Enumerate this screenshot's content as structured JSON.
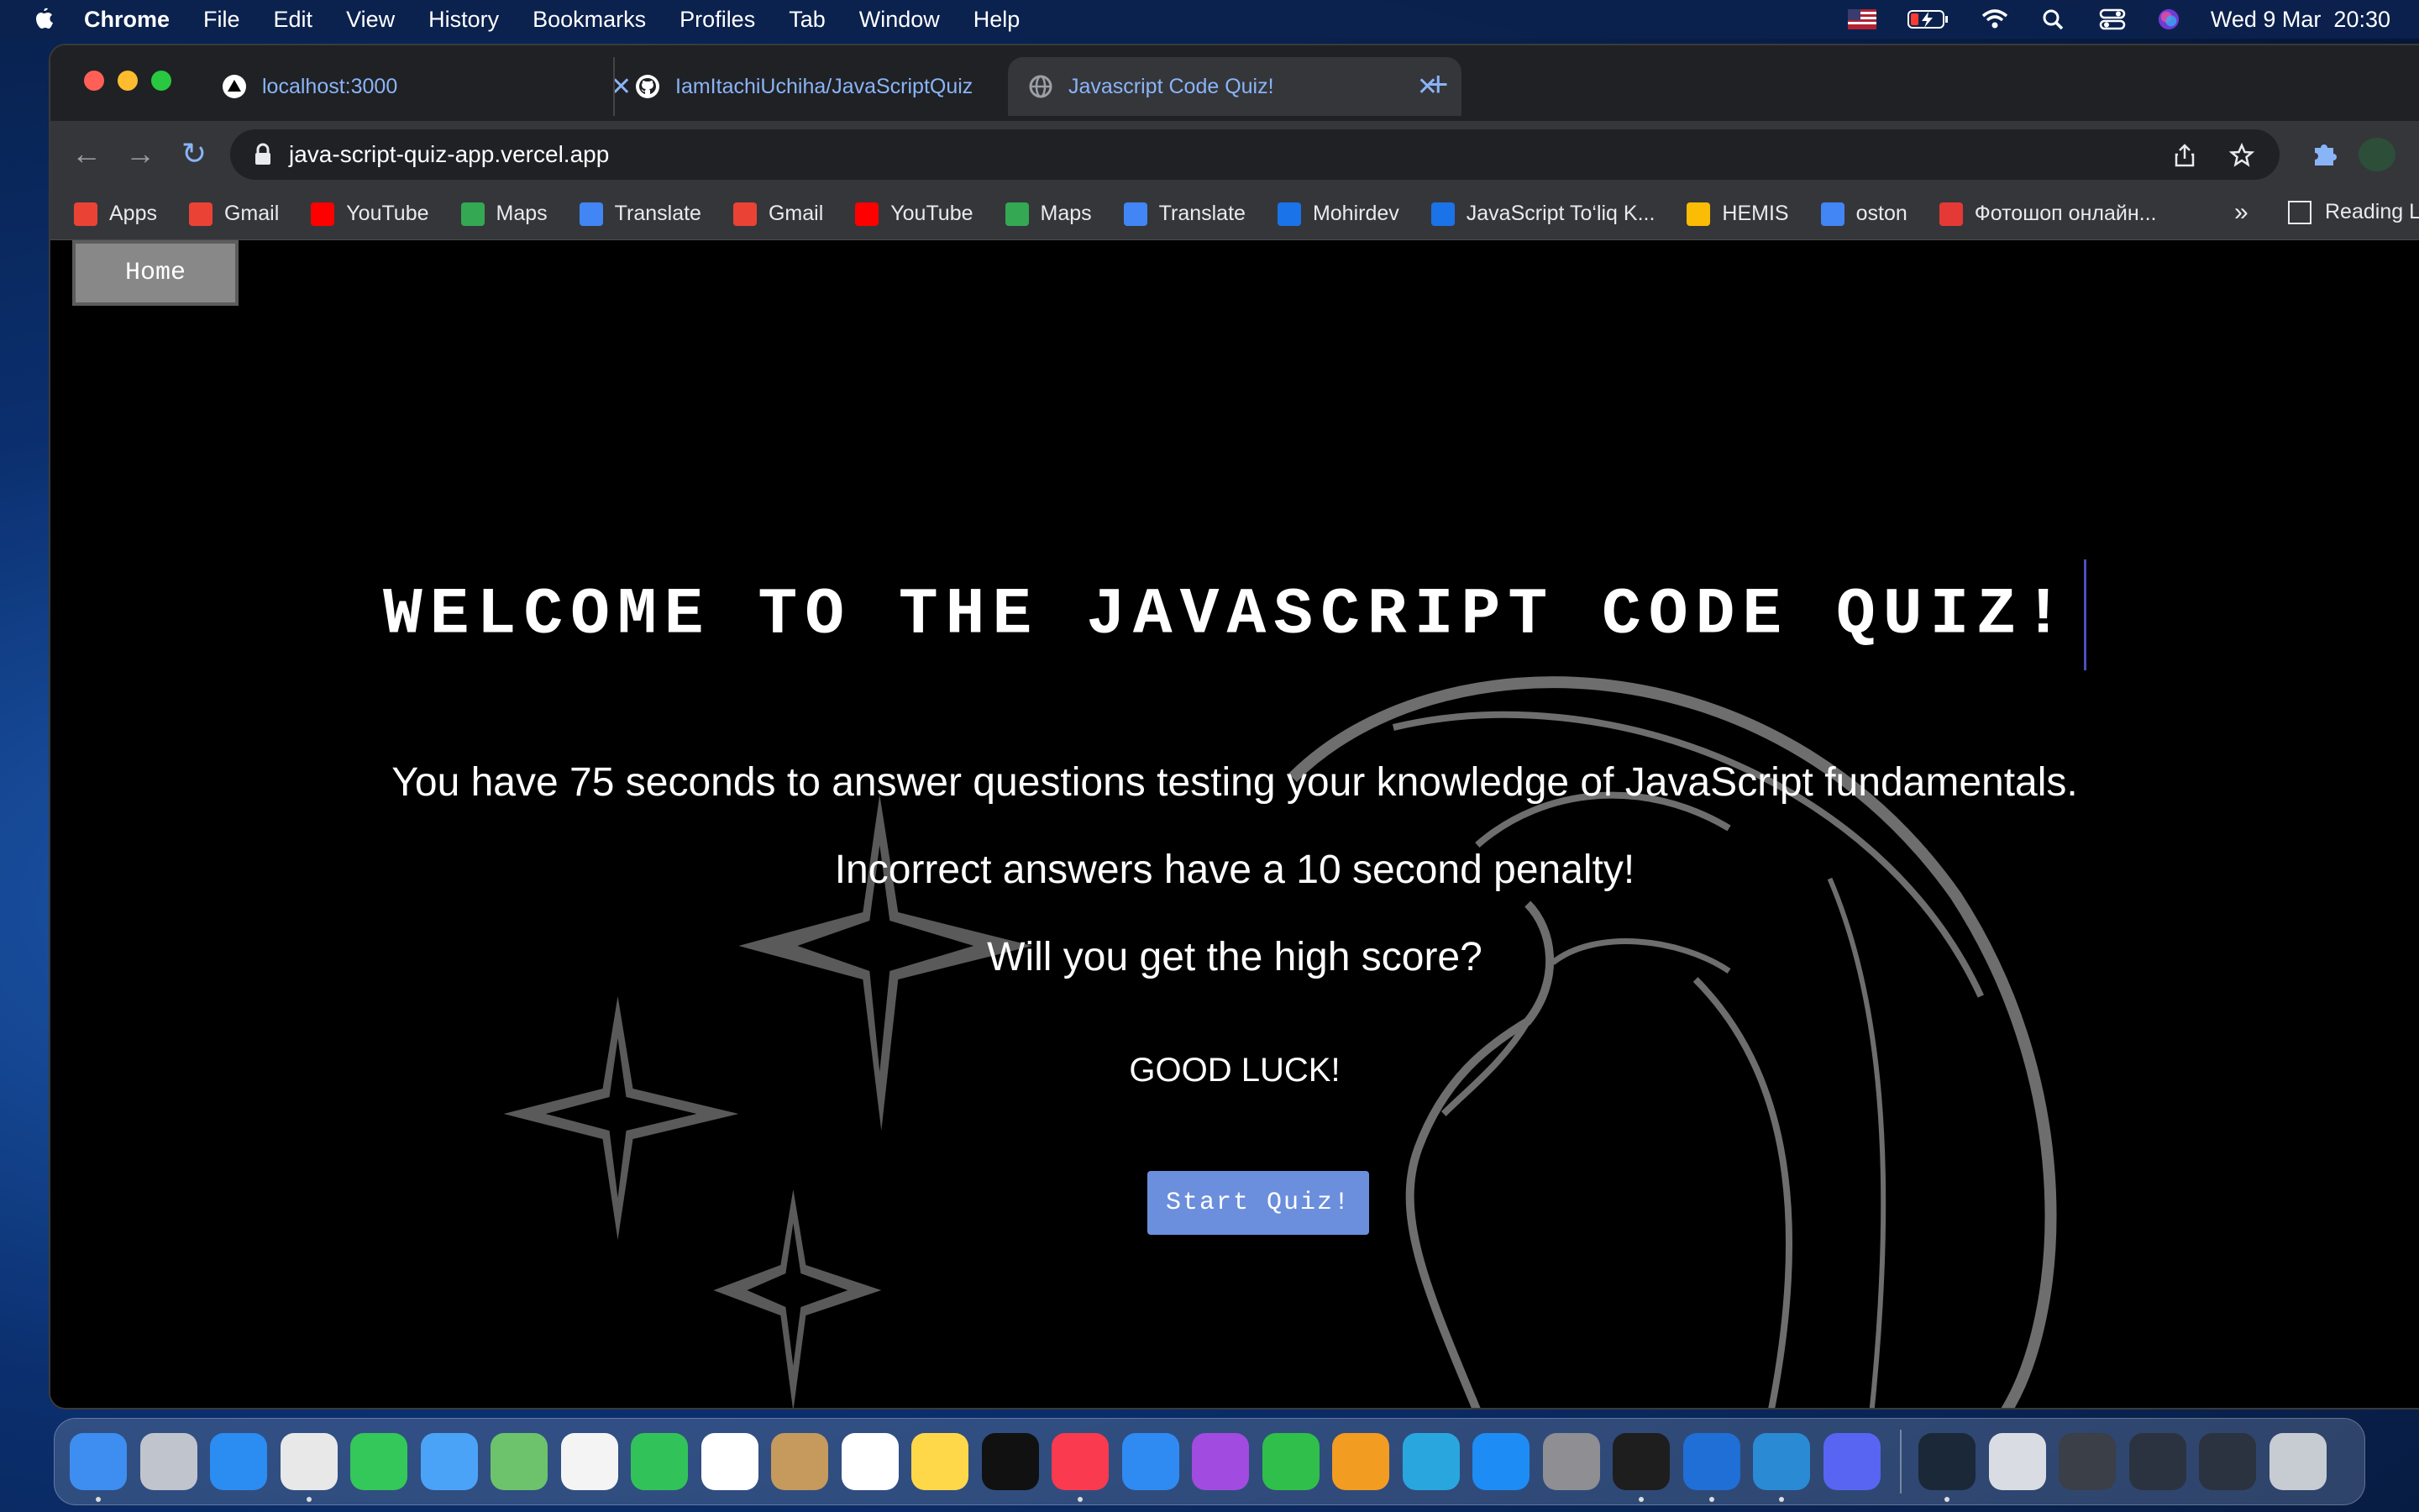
{
  "menubar": {
    "app": "Chrome",
    "items": [
      "File",
      "Edit",
      "View",
      "History",
      "Bookmarks",
      "Profiles",
      "Tab",
      "Window",
      "Help"
    ],
    "datetime": "Wed 9 Mar  20:30",
    "status_icons": [
      "flag-us-icon",
      "battery-charging-icon",
      "wifi-icon",
      "spotlight-search-icon",
      "control-center-icon",
      "siri-icon"
    ]
  },
  "tabs": [
    {
      "title": "localhost:3000",
      "icon": "vercel-triangle-icon",
      "active": false
    },
    {
      "title": "IamItachiUchiha/JavaScriptQuiz",
      "icon": "github-icon",
      "active": false
    },
    {
      "title": "Javascript Code Quiz!",
      "icon": "globe-icon",
      "active": true
    }
  ],
  "omnibox": {
    "url": "java-script-quiz-app.vercel.app"
  },
  "bookmarks": [
    {
      "label": "Apps",
      "icon": "apps-grid-icon",
      "color": "#ea4335"
    },
    {
      "label": "Gmail",
      "icon": "gmail-icon",
      "color": "#ea4335"
    },
    {
      "label": "YouTube",
      "icon": "youtube-icon",
      "color": "#ff0000"
    },
    {
      "label": "Maps",
      "icon": "maps-pin-icon",
      "color": "#34a853"
    },
    {
      "label": "Translate",
      "icon": "translate-icon",
      "color": "#4285f4"
    },
    {
      "label": "Gmail",
      "icon": "gmail-icon",
      "color": "#ea4335"
    },
    {
      "label": "YouTube",
      "icon": "youtube-icon",
      "color": "#ff0000"
    },
    {
      "label": "Maps",
      "icon": "maps-pin-icon",
      "color": "#34a853"
    },
    {
      "label": "Translate",
      "icon": "translate-icon",
      "color": "#4285f4"
    },
    {
      "label": "Mohirdev",
      "icon": "mohirdev-icon",
      "color": "#1a73e8"
    },
    {
      "label": "JavaScript To‘liq K...",
      "icon": "mohirdev-icon",
      "color": "#1a73e8"
    },
    {
      "label": "HEMIS",
      "icon": "hemis-icon",
      "color": "#fbbc05"
    },
    {
      "label": "oston",
      "icon": "key-icon",
      "color": "#4285f4"
    },
    {
      "label": "Фотошоп онлайн...",
      "icon": "arrow-red-icon",
      "color": "#e53935"
    }
  ],
  "bookmarks_more": "»",
  "reading_list": "Reading L",
  "page": {
    "home_button": "Home",
    "heading": "WELCOME TO THE JAVASCRIPT CODE QUIZ!",
    "line1": "You have 75 seconds to answer questions testing your knowledge of JavaScript fundamentals.",
    "line2": "Incorrect answers have a 10 second penalty!",
    "line3": "Will you get the high score?",
    "luck": "GOOD LUCK!",
    "start_button": "Start Quiz!",
    "accent": "#6b8fdc"
  },
  "dock": {
    "apps": [
      {
        "name": "finder-icon",
        "color": "#3d8ef0",
        "running": true
      },
      {
        "name": "launchpad-icon",
        "color": "#c0c4cc",
        "running": false
      },
      {
        "name": "safari-icon",
        "color": "#2b8cf2",
        "running": false
      },
      {
        "name": "chrome-icon",
        "color": "#e8e8e8",
        "running": true
      },
      {
        "name": "messages-icon",
        "color": "#34c759",
        "running": false
      },
      {
        "name": "mail-icon",
        "color": "#4ba3f7",
        "running": false
      },
      {
        "name": "maps-icon",
        "color": "#6cc36b",
        "running": false
      },
      {
        "name": "photos-icon",
        "color": "#f4f4f4",
        "running": false
      },
      {
        "name": "facetime-icon",
        "color": "#32c25a",
        "running": false
      },
      {
        "name": "calendar-icon",
        "color": "#ffffff",
        "running": false
      },
      {
        "name": "contacts-icon",
        "color": "#c59a5c",
        "running": false
      },
      {
        "name": "reminders-icon",
        "color": "#ffffff",
        "running": false
      },
      {
        "name": "notes-icon",
        "color": "#ffd84a",
        "running": false
      },
      {
        "name": "apple-tv-icon",
        "color": "#111111",
        "running": false
      },
      {
        "name": "music-icon",
        "color": "#fa3a4f",
        "running": true
      },
      {
        "name": "keynote-icon",
        "color": "#2f8bf2",
        "running": false
      },
      {
        "name": "podcasts-icon",
        "color": "#a24be0",
        "running": false
      },
      {
        "name": "numbers-icon",
        "color": "#2fbf4a",
        "running": false
      },
      {
        "name": "pages-icon",
        "color": "#f39c22",
        "running": false
      },
      {
        "name": "telegram-icon",
        "color": "#2aa6df",
        "running": false
      },
      {
        "name": "app-store-icon",
        "color": "#1d8cf4",
        "running": false
      },
      {
        "name": "system-preferences-icon",
        "color": "#8e8e93",
        "running": false
      },
      {
        "name": "terminal-icon",
        "color": "#1e1e1e",
        "running": true
      },
      {
        "name": "webstorm-icon",
        "color": "#1f6fd6",
        "running": true
      },
      {
        "name": "vscode-icon",
        "color": "#2a8ad4",
        "running": true
      },
      {
        "name": "discord-icon",
        "color": "#5865f2",
        "running": false
      }
    ],
    "others": [
      {
        "name": "steam-icon",
        "color": "#1b2838",
        "running": true
      },
      {
        "name": "preview-icon",
        "color": "#d9dde3",
        "running": false
      },
      {
        "name": "quicktime-icon",
        "color": "#3a3f48",
        "running": false
      },
      {
        "name": "minimized-window-1-icon",
        "color": "#2b3340",
        "running": false
      },
      {
        "name": "minimized-window-2-icon",
        "color": "#2b3340",
        "running": false
      },
      {
        "name": "trash-icon",
        "color": "#c7ccd3",
        "running": false
      }
    ]
  }
}
